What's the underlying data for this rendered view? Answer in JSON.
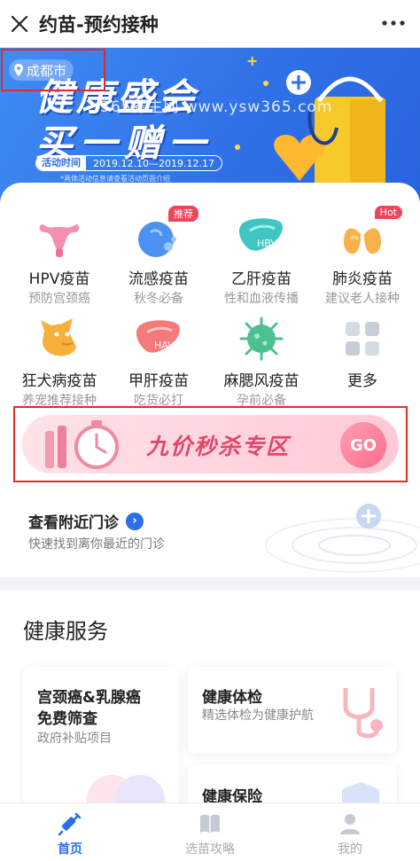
{
  "topbar": {
    "title": "约苗-预约接种"
  },
  "banner": {
    "city": "成都市",
    "headline_line1": "健康盛会",
    "headline_line2": "买一赠一",
    "watermark": "365养生网 www.ysw365.com",
    "period_label": "活动时间",
    "period_value": "2019.12.10—2019.12.17",
    "note": "*具体活动信息请查看活动页面介绍"
  },
  "vaccines": [
    {
      "name": "HPV疫苗",
      "sub": "预防宫颈癌",
      "icon": "uterus-icon",
      "tag": ""
    },
    {
      "name": "流感疫苗",
      "sub": "秋冬必备",
      "icon": "flu-icon",
      "tag": "推荐"
    },
    {
      "name": "乙肝疫苗",
      "sub": "性和血液传播",
      "icon": "liver-hbv-icon",
      "tag": ""
    },
    {
      "name": "肺炎疫苗",
      "sub": "建议老人接种",
      "icon": "lungs-icon",
      "tag": "Hot"
    },
    {
      "name": "狂犬病疫苗",
      "sub": "养宠推荐接种",
      "icon": "dog-icon",
      "tag": ""
    },
    {
      "name": "甲肝疫苗",
      "sub": "吃货必打",
      "icon": "liver-hav-icon",
      "tag": ""
    },
    {
      "name": "麻腮风疫苗",
      "sub": "孕前必备",
      "icon": "virus-icon",
      "tag": ""
    },
    {
      "name": "更多",
      "sub": "",
      "icon": "grid-more-icon",
      "tag": ""
    }
  ],
  "promo": {
    "text": "九价秒杀专区",
    "go": "GO"
  },
  "nearby": {
    "title": "查看附近门诊",
    "sub": "快速找到离你最近的门诊"
  },
  "services": {
    "title": "健康服务",
    "cards": [
      {
        "title_line1": "宫颈癌&乳腺癌",
        "title_line2": "免费筛查",
        "sub": "政府补贴项目"
      },
      {
        "title_line1": "健康体检",
        "title_line2": "",
        "sub": "精选体检为健康护航"
      },
      {
        "title_line1": "健康保险",
        "title_line2": "",
        "sub": ""
      }
    ]
  },
  "tabs": [
    {
      "label": "首页",
      "icon": "syringe-icon",
      "active": true
    },
    {
      "label": "选苗攻略",
      "icon": "book-icon",
      "active": false
    },
    {
      "label": "我的",
      "icon": "user-icon",
      "active": false
    }
  ],
  "colors": {
    "accent": "#2b6fe8",
    "banner": "#3578ee",
    "promo_text": "#e2466a",
    "tag": "#f0445c"
  }
}
